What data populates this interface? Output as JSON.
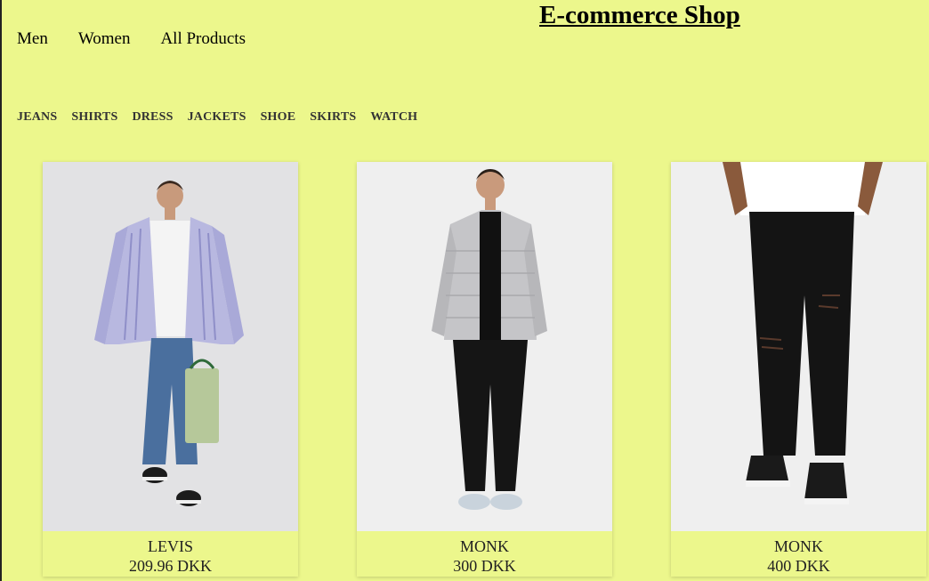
{
  "header": {
    "title": "E-commerce Shop"
  },
  "main_nav": [
    {
      "label": "Men"
    },
    {
      "label": "Women"
    },
    {
      "label": "All Products"
    }
  ],
  "categories": [
    {
      "label": "JEANS"
    },
    {
      "label": "SHIRTS"
    },
    {
      "label": "DRESS"
    },
    {
      "label": "JACKETS"
    },
    {
      "label": "SHOE"
    },
    {
      "label": "SKIRTS"
    },
    {
      "label": "WATCH"
    }
  ],
  "products": [
    {
      "brand": "LEVIS",
      "price": "209.96 DKK"
    },
    {
      "brand": "MONK",
      "price": "300 DKK"
    },
    {
      "brand": "MONK",
      "price": "400 DKK"
    }
  ],
  "colors": {
    "background": "#ecf78c",
    "text": "#111111"
  }
}
